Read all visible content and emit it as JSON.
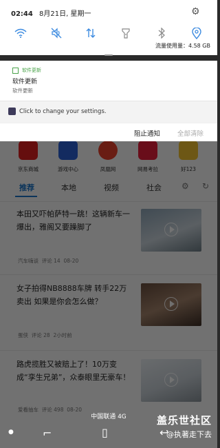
{
  "status_bar": {
    "time": "02:44",
    "date": "8月21日, 星期一"
  },
  "quick_settings": {
    "data_usage": "流量使用量：4.58 GB",
    "toggles": [
      "wifi-icon",
      "mute-icon",
      "data-transfer-icon",
      "flashlight-icon",
      "bluetooth-icon",
      "location-icon"
    ]
  },
  "notifications": {
    "software_update": {
      "app_name": "软件更新",
      "title": "软件更新",
      "body": "软件更新"
    },
    "settings": {
      "text": "Click to change your settings."
    },
    "block_label": "阻止通知",
    "clear_label": "全部清除"
  },
  "background_app": {
    "apps": [
      {
        "label": "京东商城",
        "color": "#e02020"
      },
      {
        "label": "游戏中心",
        "color": "#2a5fd6"
      },
      {
        "label": "凤凰网",
        "color": "#e8402a"
      },
      {
        "label": "网易考拉",
        "color": "#e81e3b"
      },
      {
        "label": "好123",
        "color": "#f2c230"
      }
    ],
    "tabs": [
      "推荐",
      "本地",
      "视频",
      "社会"
    ],
    "articles": [
      {
        "title": "本田又吓帕萨特一跳！这辆新车一爆出，雅阁又要躁脚了",
        "source": "汽车嗨谈",
        "comments": "评论 14",
        "date": "08-20"
      },
      {
        "title": "女子拍得NB8888车牌 转手22万卖出 如果是你会怎么做？",
        "source": "蛋侠",
        "comments": "评论 28",
        "date": "2小时前"
      },
      {
        "title": "路虎揽胜又被赔上了！10万变成“孪生兄弟”，众泰眼里无豪车！",
        "source": "爱看抽车",
        "comments": "评论 498",
        "date": "08-20"
      }
    ]
  },
  "carrier": "中国联通 4G",
  "watermark": {
    "line1": "盖乐世社区",
    "line2": "@执著走下去"
  },
  "colors": {
    "accent": "#1a73c8",
    "qs_blue": "#3d8be0",
    "update_green": "#4aa34a"
  }
}
